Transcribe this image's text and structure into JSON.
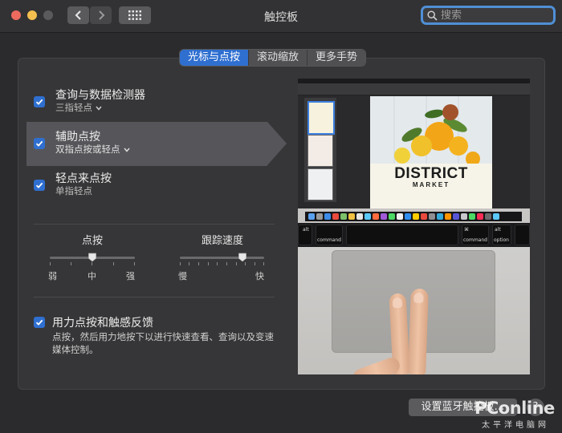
{
  "window": {
    "title": "触控板",
    "search": {
      "placeholder": "搜索",
      "value": ""
    }
  },
  "tabs": [
    {
      "label": "光标与点按",
      "active": true
    },
    {
      "label": "滚动缩放",
      "active": false
    },
    {
      "label": "更多手势",
      "active": false
    }
  ],
  "options": {
    "lookup": {
      "label": "查询与数据检测器",
      "sub": "三指轻点",
      "checked": true,
      "has_menu": true
    },
    "secondary_click": {
      "label": "辅助点按",
      "sub": "双指点按或轻点",
      "checked": true,
      "has_menu": true,
      "highlighted": true
    },
    "tap_to_click": {
      "label": "轻点来点按",
      "sub": "单指轻点",
      "checked": true,
      "has_menu": false
    },
    "force_click": {
      "label": "用力点按和触感反馈",
      "description": "点按，然后用力地按下以进行快速查看、查询以及变速媒体控制。",
      "checked": true
    }
  },
  "sliders": {
    "click": {
      "title": "点按",
      "labels": [
        "弱",
        "中",
        "强"
      ],
      "value_fraction": 0.5
    },
    "tracking": {
      "title": "跟踪速度",
      "labels": [
        "慢",
        "快"
      ],
      "value_fraction": 0.7
    }
  },
  "preview": {
    "doc_title": "DISTRICT",
    "doc_subtitle": "MARKET",
    "keys": {
      "left_alt": "alt",
      "left_cmd": "command",
      "cmd_symbol": "⌘",
      "right_cmd": "command",
      "right_alt": "option",
      "right_alt_top": "alt"
    }
  },
  "buttons": {
    "setup_bluetooth": "设置蓝牙触控板…",
    "help": "?"
  },
  "watermark": {
    "text": "PConline",
    "sub": "太平洋电脑网"
  },
  "colors": {
    "accent": "#2f6fd0",
    "window_bg": "#2b2b2d",
    "search_focus": "#4f8fd6"
  }
}
